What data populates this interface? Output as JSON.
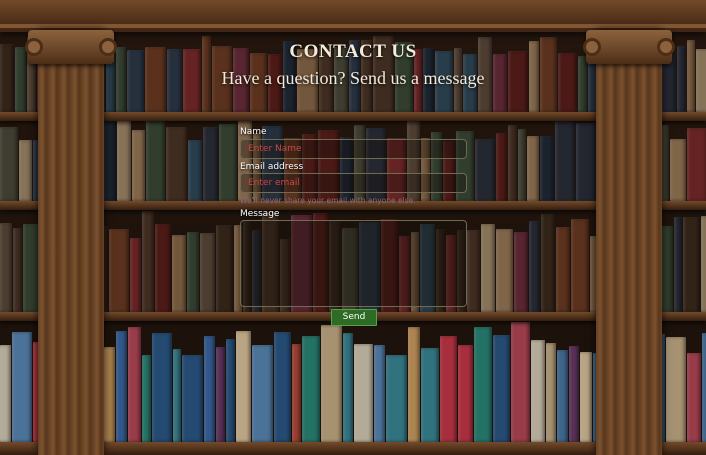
{
  "heading": {
    "title": "CONTACT US",
    "subtitle": "Have a question? Send us a message"
  },
  "form": {
    "name_label": "Name",
    "name_placeholder": "Enter Name",
    "email_label": "Email address",
    "email_placeholder": "Enter email",
    "email_help": "We'll never share your email with anyone else.",
    "message_label": "Message",
    "message_value": "",
    "send_label": "Send"
  },
  "colors": {
    "placeholder_text": "#c9484a",
    "field_border": "#6f6a52",
    "send_button": "#2e6b25",
    "heading_text": "#f4ead9"
  }
}
